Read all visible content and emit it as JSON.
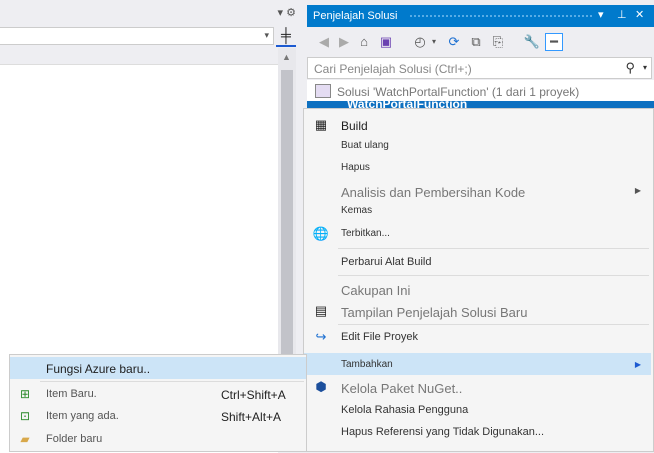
{
  "explorer": {
    "title": "Penjelajah Solusi",
    "search_placeholder": "Cari Penjelajah Solusi (Ctrl+;)",
    "solution_label": "Solusi 'WatchPortalFunction' (1 dari 1 proyek)",
    "project_label": "WatchPortalFunction"
  },
  "context_menu": {
    "build": "Build",
    "rebuild": "Buat ulang",
    "clean": "Hapus",
    "analyze": "Analisis dan Pembersihan Kode",
    "pack": "Kemas",
    "publish": "Terbitkan...",
    "update_build_tools": "Perbarui Alat Build",
    "scope_to_this": "Cakupan Ini",
    "new_explorer_view": "Tampilan Penjelajah Solusi Baru",
    "edit_project_file": "Edit File Proyek",
    "add": "Tambahkan",
    "manage_nuget": "Kelola Paket NuGet..",
    "manage_secrets": "Kelola Rahasia Pengguna",
    "remove_unused_refs": "Hapus Referensi yang Tidak Digunakan..."
  },
  "add_submenu": {
    "new_azure_function": "Fungsi Azure baru..",
    "new_item": "Item Baru.",
    "new_item_shortcut": "Ctrl+Shift+A",
    "existing_item": "Item yang ada.",
    "existing_item_shortcut": "Shift+Alt+A",
    "new_folder": "Folder baru"
  },
  "colors": {
    "accent": "#007acc",
    "selection": "#cce4f7",
    "project_row": "#0e70c0"
  }
}
